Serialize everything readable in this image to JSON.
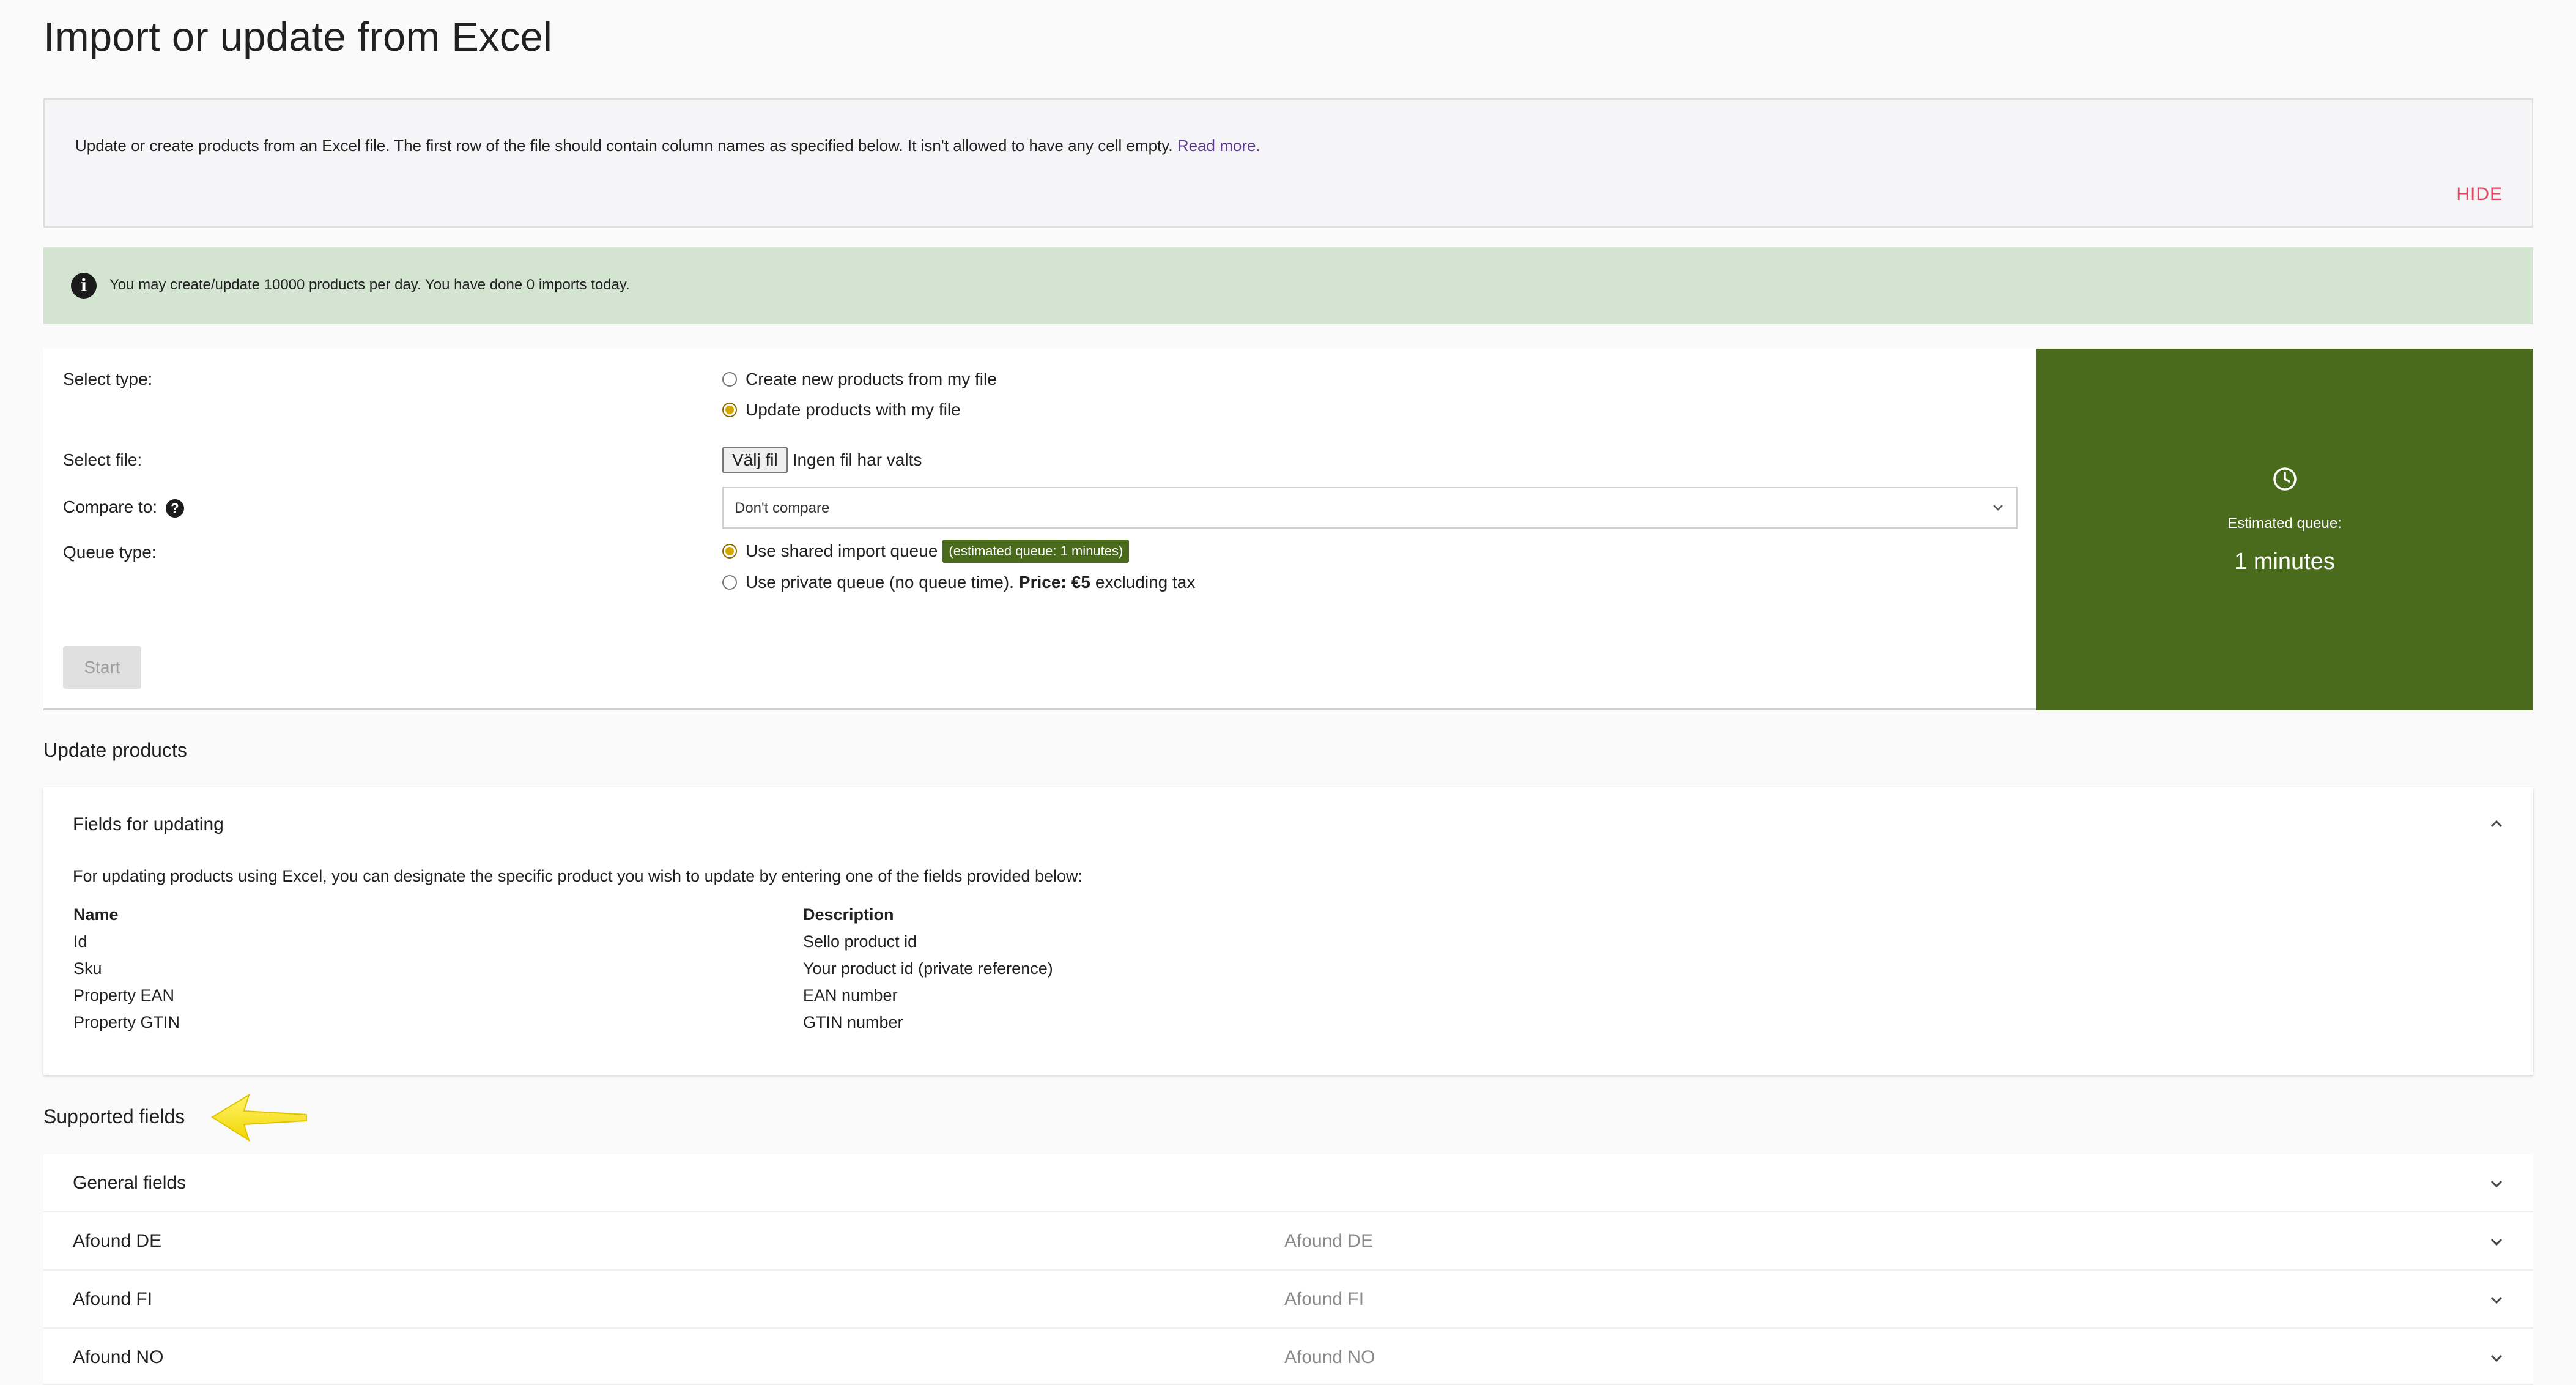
{
  "page": {
    "title": "Import or update from Excel"
  },
  "info": {
    "text": "Update or create products from an Excel file. The first row of the file should contain column names as specified below. It isn't allowed to have any cell empty.",
    "read_more": "Read more.",
    "hide": "HIDE"
  },
  "alert": {
    "icon": "info-icon",
    "text": "You may create/update 10000 products per day. You have done 0 imports today."
  },
  "form": {
    "select_type_label": "Select type:",
    "type_options": [
      {
        "label": "Create new products from my file",
        "checked": false
      },
      {
        "label": "Update products with my file",
        "checked": true
      }
    ],
    "select_file_label": "Select file:",
    "file_button": "Välj fil",
    "file_status": "Ingen fil har valts",
    "compare_label": "Compare to:",
    "compare_value": "Don't compare",
    "queue_label": "Queue type:",
    "queue_shared": "Use shared import queue",
    "queue_badge": "(estimated queue: 1 minutes)",
    "queue_private": "Use private queue (no queue time).",
    "price_label": "Price:",
    "price_value": "€5",
    "price_suffix": "excluding tax",
    "start": "Start"
  },
  "queue": {
    "label": "Estimated queue:",
    "value": "1 minutes",
    "color": "#4a6b1c"
  },
  "update": {
    "section_title": "Update products",
    "panel_title": "Fields for updating",
    "intro": "For updating products using Excel, you can designate the specific product you wish to update by entering one of the fields provided below:",
    "columns": [
      "Name",
      "Description"
    ],
    "rows": [
      [
        "Id",
        "Sello product id"
      ],
      [
        "Sku",
        "Your product id (private reference)"
      ],
      [
        "Property EAN",
        "EAN number"
      ],
      [
        "Property GTIN",
        "GTIN number"
      ]
    ]
  },
  "supported": {
    "section_title": "Supported fields",
    "rows": [
      {
        "name": "General fields",
        "sub": ""
      },
      {
        "name": "Afound DE",
        "sub": "Afound DE"
      },
      {
        "name": "Afound FI",
        "sub": "Afound FI"
      },
      {
        "name": "Afound NO",
        "sub": "Afound NO"
      }
    ]
  }
}
